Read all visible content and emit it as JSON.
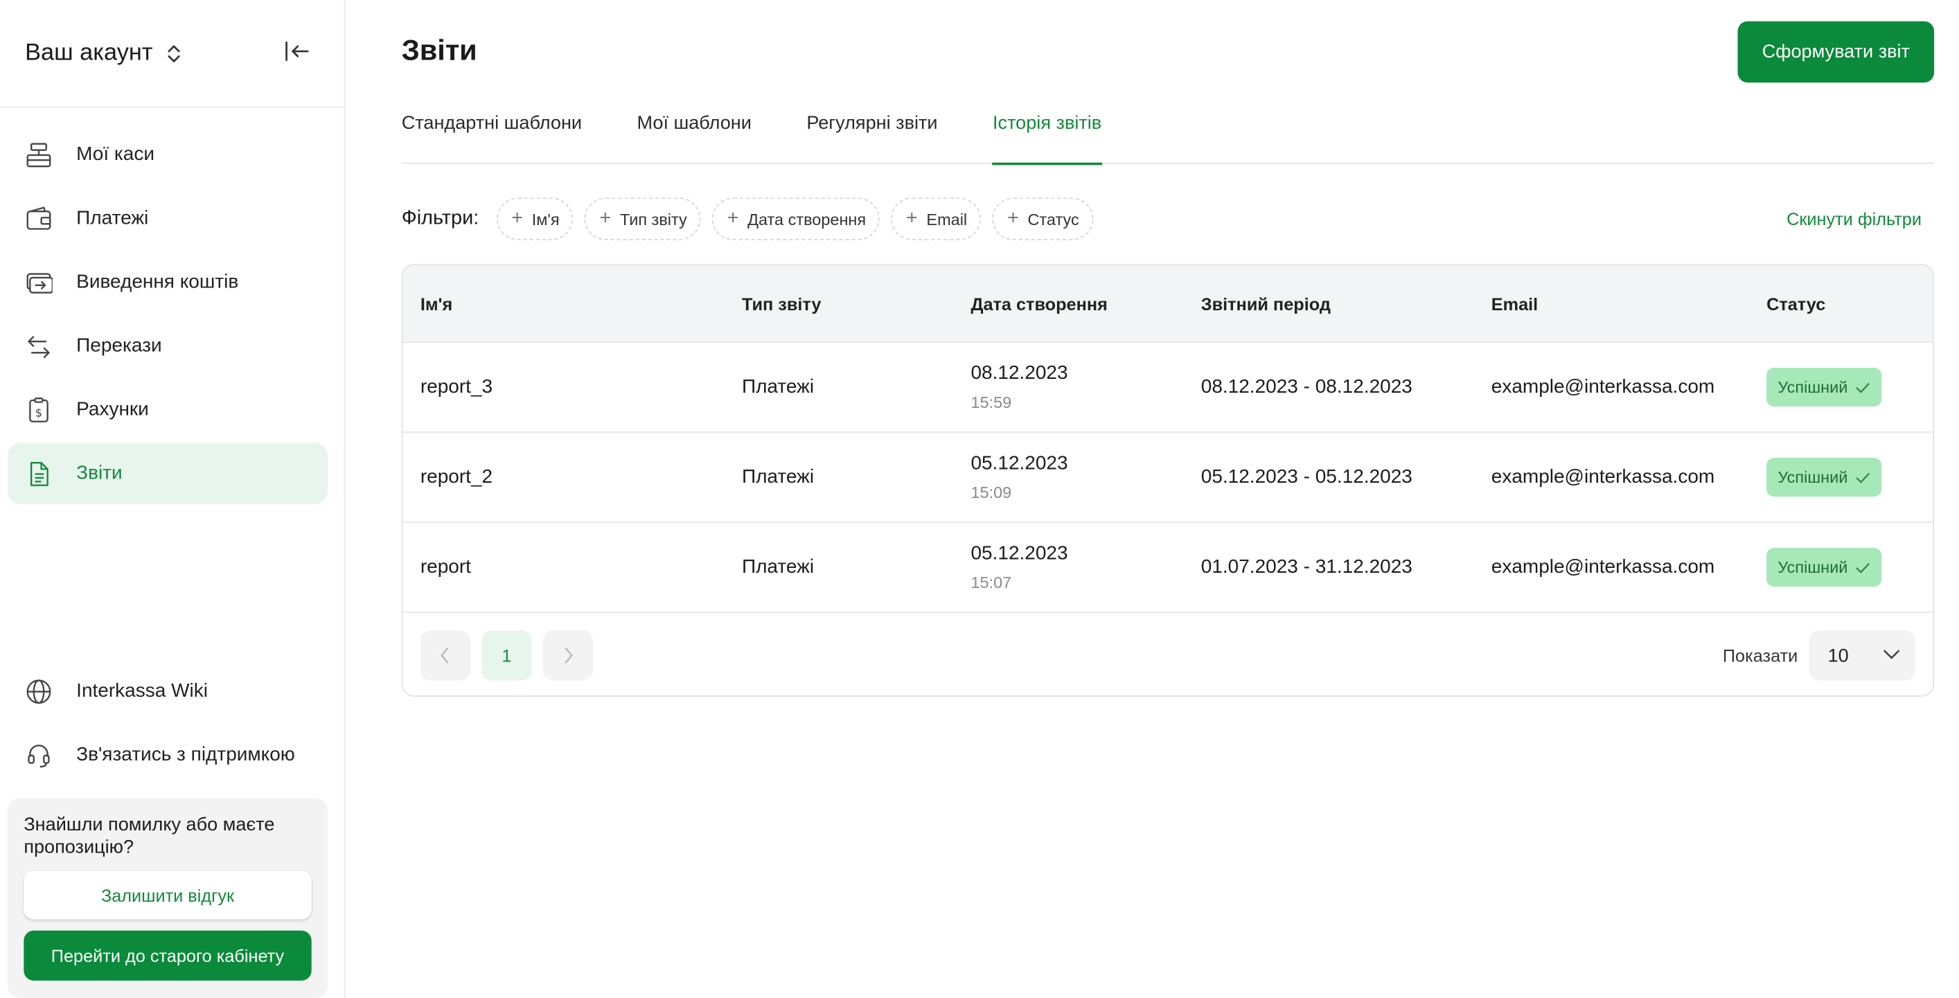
{
  "account": {
    "title": "Ваш акаунт",
    "switch_icon": "chevron-up-down-icon",
    "collapse_icon": "collapse-sidebar-icon"
  },
  "sidebar": {
    "items": [
      {
        "label": "Мої каси",
        "icon": "cash-register-icon"
      },
      {
        "label": "Платежі",
        "icon": "wallet-icon"
      },
      {
        "label": "Виведення коштів",
        "icon": "withdraw-icon"
      },
      {
        "label": "Перекази",
        "icon": "transfer-icon"
      },
      {
        "label": "Рахунки",
        "icon": "invoice-icon"
      },
      {
        "label": "Звіти",
        "icon": "report-icon",
        "active": true
      }
    ],
    "bottom_items": [
      {
        "label": "Interkassa Wiki",
        "icon": "globe-icon"
      },
      {
        "label": "Зв'язатись з підтримкою",
        "icon": "headset-icon"
      }
    ],
    "feedback": {
      "text": "Знайшли помилку або маєте пропозицію?",
      "leave_feedback": "Залишити відгук",
      "old_cabinet": "Перейти до старого кабінету"
    }
  },
  "header": {
    "title": "Звіти",
    "create_button": "Сформувати звіт"
  },
  "tabs": [
    {
      "label": "Стандартні шаблони"
    },
    {
      "label": "Мої шаблони"
    },
    {
      "label": "Регулярні звіти"
    },
    {
      "label": "Історія звітів",
      "active": true
    }
  ],
  "filters": {
    "label": "Фільтри:",
    "chips": [
      "Ім'я",
      "Тип звіту",
      "Дата створення",
      "Email",
      "Статус"
    ],
    "reset": "Скинути фільтри"
  },
  "table": {
    "columns": [
      "Ім'я",
      "Тип звіту",
      "Дата створення",
      "Звітний період",
      "Email",
      "Статус"
    ],
    "rows": [
      {
        "name": "report_3",
        "type": "Платежі",
        "date": "08.12.2023",
        "time": "15:59",
        "period": "08.12.2023 - 08.12.2023",
        "email": "example@interkassa.com",
        "status": "Успішний"
      },
      {
        "name": "report_2",
        "type": "Платежі",
        "date": "05.12.2023",
        "time": "15:09",
        "period": "05.12.2023 - 05.12.2023",
        "email": "example@interkassa.com",
        "status": "Успішний"
      },
      {
        "name": "report",
        "type": "Платежі",
        "date": "05.12.2023",
        "time": "15:07",
        "period": "01.07.2023 - 31.12.2023",
        "email": "example@interkassa.com",
        "status": "Успішний"
      }
    ]
  },
  "pagination": {
    "current_page": "1",
    "show_label": "Показати",
    "page_size": "10"
  },
  "colors": {
    "brand_green": "#0a8a3a",
    "accent_text": "#128a3c",
    "active_bg": "#e8f5ec",
    "badge_bg": "#a6e8b8"
  }
}
